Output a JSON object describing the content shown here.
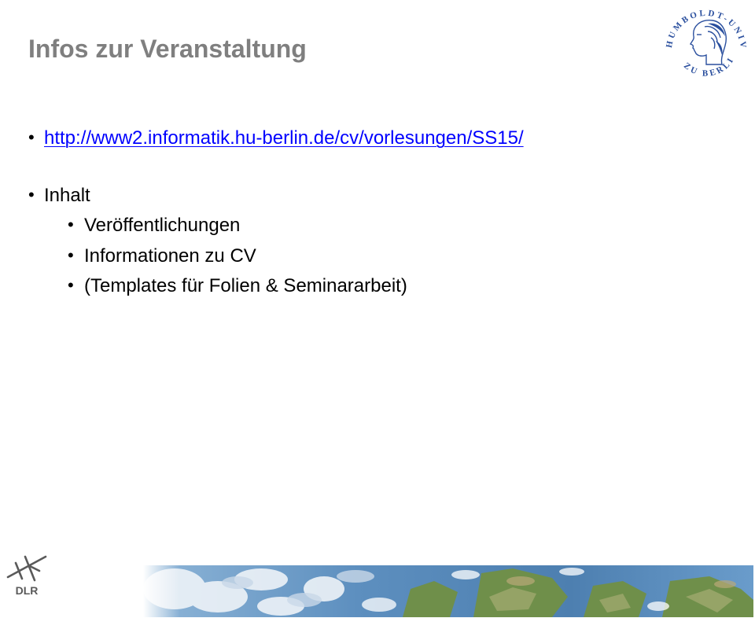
{
  "slide": {
    "title": "Infos zur Veranstaltung",
    "link": "http://www2.informatik.hu-berlin.de/cv/vorlesungen/SS15/",
    "section_label": "Inhalt",
    "sub_items": [
      "Veröffentlichungen",
      "Informationen zu CV",
      "(Templates für Folien & Seminararbeit)"
    ],
    "bullet_char": "•"
  },
  "logos": {
    "university_seal_text": "HUMBOLDT-UNIVERSITÄT ZU BERLIN",
    "dlr_text": "DLR"
  },
  "colors": {
    "title": "#7f7f7f",
    "link": "#0000ff",
    "body_text": "#000000",
    "seal": "#2a4f9e",
    "dlr": "#5a5a5a"
  }
}
